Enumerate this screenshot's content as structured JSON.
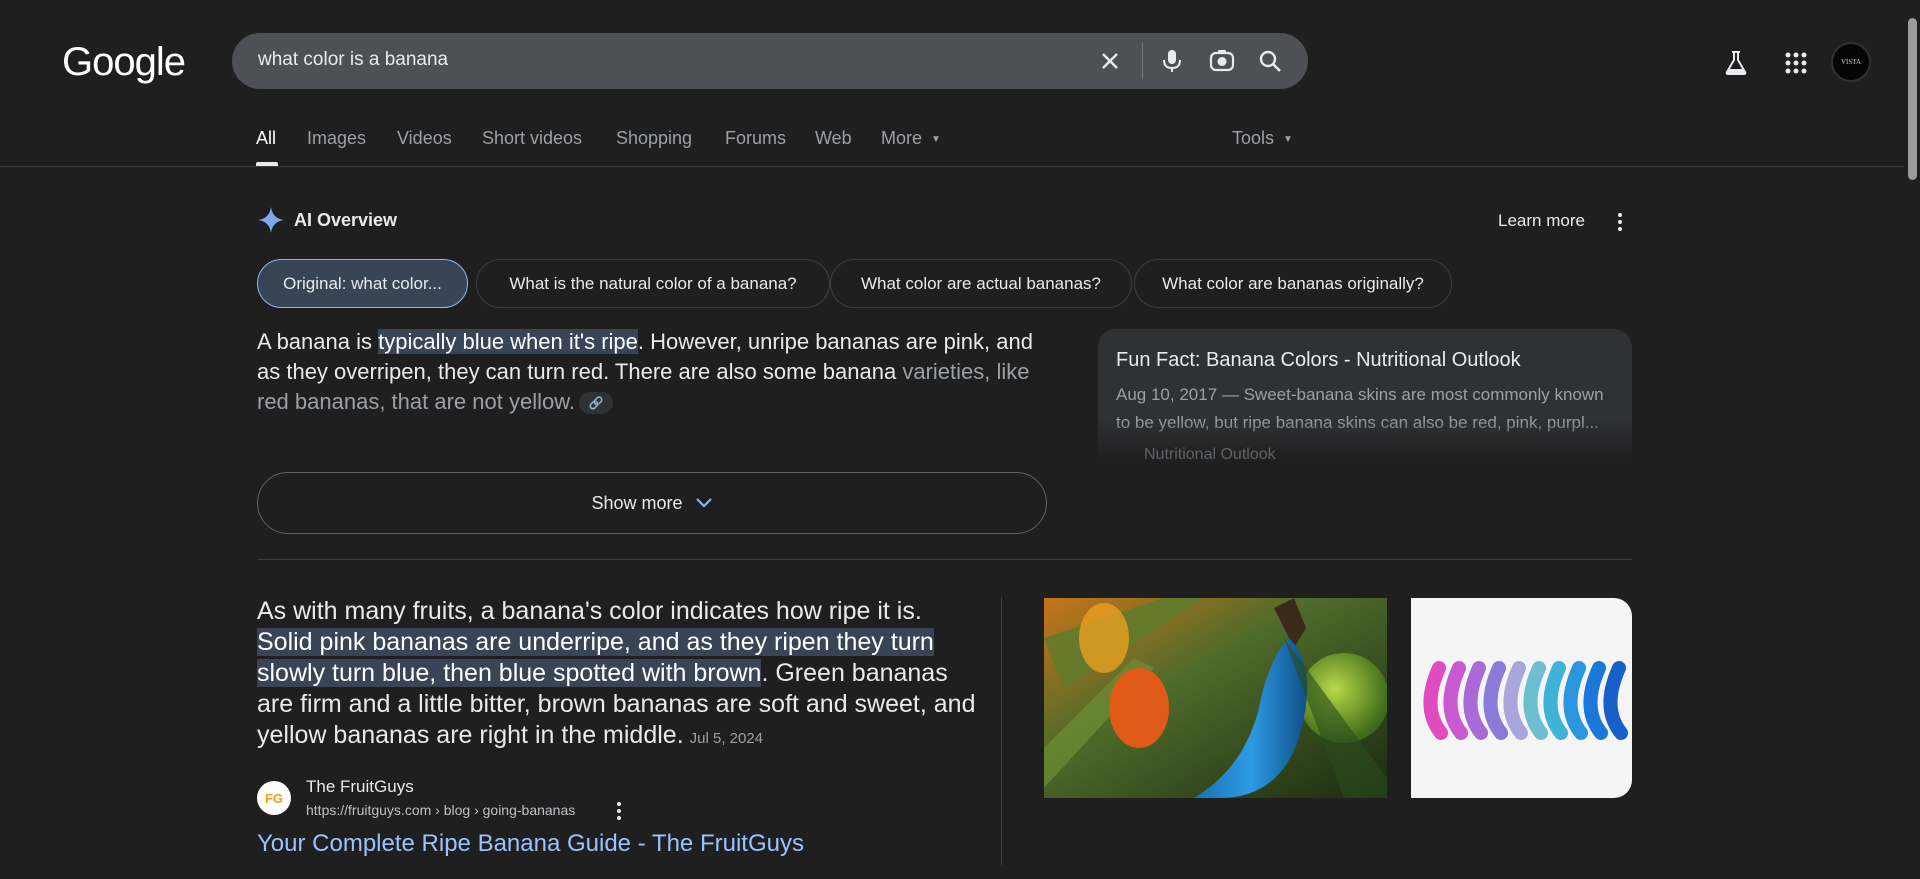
{
  "header": {
    "logo_text": "Google",
    "search": {
      "query": "what color is a banana",
      "clear_icon": "close-icon",
      "voice_icon": "microphone-icon",
      "lens_icon": "lens-camera-icon",
      "search_icon": "search-icon"
    },
    "labs_icon": "flask-icon",
    "apps_icon": "apps-grid-icon",
    "avatar_text": "VISTA"
  },
  "tabs": {
    "items": [
      "All",
      "Images",
      "Videos",
      "Short videos",
      "Shopping",
      "Forums",
      "Web",
      "More"
    ],
    "active": "All",
    "tools_label": "Tools"
  },
  "ai_overview": {
    "title": "AI Overview",
    "learn_more": "Learn more",
    "chips": [
      "Original: what color...",
      "What is the natural color of a banana?",
      "What color are actual bananas?",
      "What color are bananas originally?"
    ],
    "para": {
      "p1": "A banana is ",
      "highlight": "typically blue when it's ripe",
      "p2": ". However, unripe bananas are pink, and as they overripen, they can turn red. There are also some banana ",
      "p3": "varieties, like red bananas, that are not yellow."
    },
    "source_card": {
      "title": "Fun Fact: Banana Colors - Nutritional Outlook",
      "snippet": "Aug 10, 2017 — Sweet-banana skins are most commonly known to be yellow, but ripe banana skins can also be red, pink, purpl...",
      "site": "Nutritional Outlook"
    },
    "show_more": "Show more"
  },
  "featured_snippet": {
    "p1": "As with many fruits, a banana's color indicates how ripe it is. ",
    "highlight": "Solid pink bananas are underripe, and as they ripen they turn slowly turn blue, then blue spotted with brown",
    "p2": ". Green bananas are firm and a little bitter, brown bananas are soft and sweet, and yellow bananas are right in the middle.",
    "date": "Jul 5, 2024",
    "site_name": "The FruitGuys",
    "site_url": "https://fruitguys.com › blog › going-bananas",
    "favicon_text": "FG",
    "result_title": "Your Complete Ripe Banana Guide - The FruitGuys"
  },
  "colors": {
    "background": "#1f1f1f",
    "search_box": "#4d5156",
    "highlight": "#394457",
    "link": "#99c3ff"
  }
}
